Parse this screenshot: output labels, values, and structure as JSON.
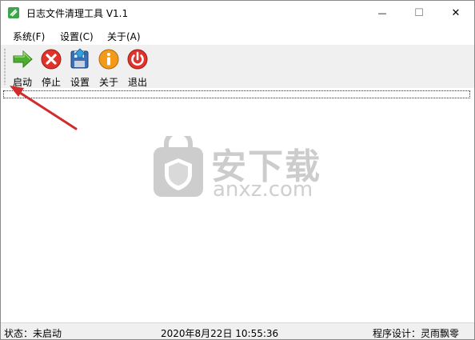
{
  "window": {
    "title": "日志文件清理工具 V1.1",
    "controls": {
      "minimize": "—",
      "maximize": "☐",
      "close": "✕"
    }
  },
  "menu": [
    {
      "label": "系统(F)"
    },
    {
      "label": "设置(C)"
    },
    {
      "label": "关于(A)"
    }
  ],
  "toolbar": [
    {
      "label": "启动",
      "icon": "green-arrow-icon"
    },
    {
      "label": "停止",
      "icon": "red-x-icon"
    },
    {
      "label": "设置",
      "icon": "floppy-settings-icon"
    },
    {
      "label": "关于",
      "icon": "info-icon"
    },
    {
      "label": "退出",
      "icon": "power-icon"
    }
  ],
  "watermark": {
    "cn": "安下载",
    "en": "anxz.com"
  },
  "statusbar": {
    "status": "状态：未启动",
    "datetime": "2020年8月22日  10:55:36",
    "author": "程序设计：灵雨飘零"
  },
  "colors": {
    "arrow": "#d22b2b",
    "toolbar_bg": "#f0f0f0",
    "status_bg": "#f0f0f0"
  }
}
